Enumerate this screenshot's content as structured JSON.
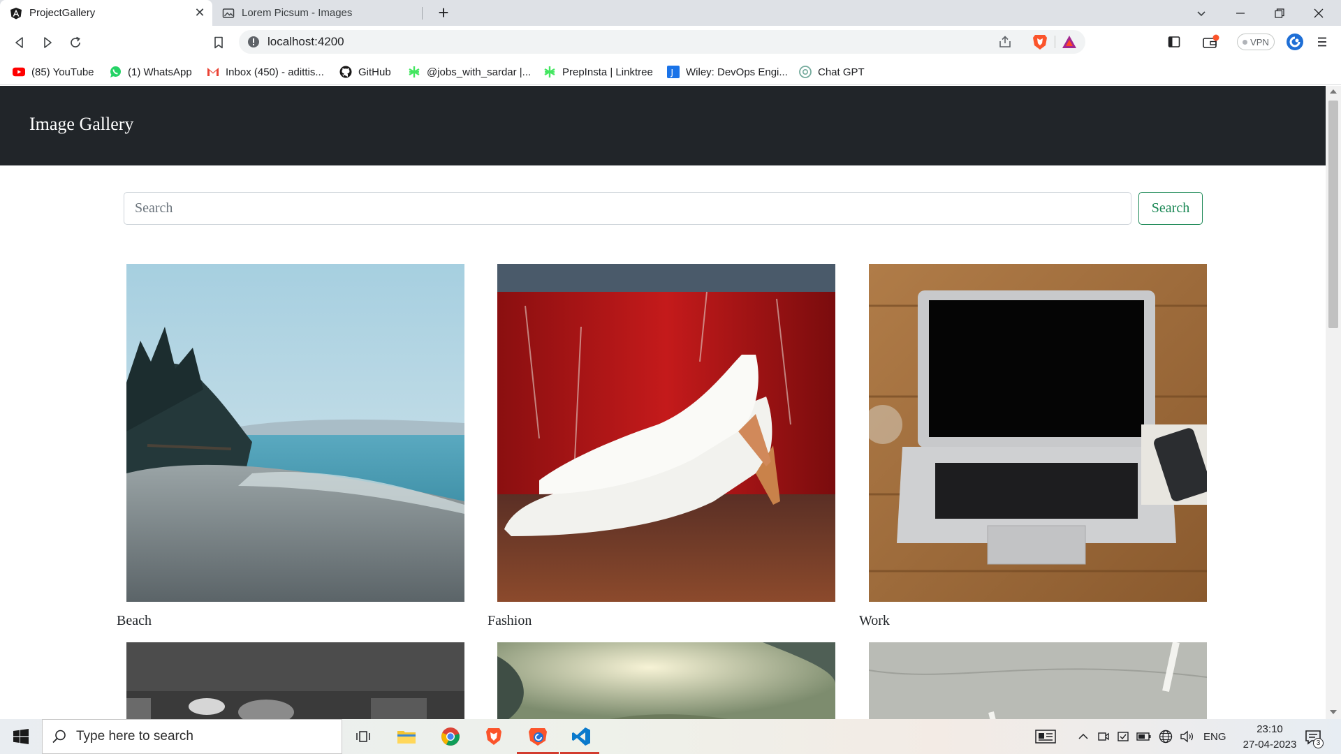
{
  "browser": {
    "tabs": [
      {
        "title": "ProjectGallery",
        "active": true,
        "icon": "angular-icon"
      },
      {
        "title": "Lorem Picsum - Images",
        "active": false,
        "icon": "image-icon"
      }
    ],
    "url": "localhost:4200",
    "vpn_label": "VPN",
    "bookmarks": [
      {
        "label": "(85) YouTube",
        "icon": "youtube-icon",
        "color": "#ff0000"
      },
      {
        "label": "(1) WhatsApp",
        "icon": "whatsapp-icon",
        "color": "#25d366"
      },
      {
        "label": "Inbox (450) - adittis...",
        "icon": "gmail-icon",
        "color": "#ea4335"
      },
      {
        "label": "GitHub",
        "icon": "github-icon",
        "color": "#181717"
      },
      {
        "label": "@jobs_with_sardar |...",
        "icon": "linktree-icon",
        "color": "#43e660"
      },
      {
        "label": "PrepInsta | Linktree",
        "icon": "linktree-icon",
        "color": "#43e660"
      },
      {
        "label": "Wiley: DevOps Engi...",
        "icon": "wiley-icon",
        "color": "#1a73e8"
      },
      {
        "label": "Chat GPT",
        "icon": "chatgpt-icon",
        "color": "#74aa9c"
      }
    ]
  },
  "app": {
    "brand": "Image Gallery",
    "search": {
      "placeholder": "Search",
      "value": "",
      "button_label": "Search"
    },
    "cards": [
      {
        "caption": "Beach"
      },
      {
        "caption": "Fashion"
      },
      {
        "caption": "Work"
      },
      {
        "caption": ""
      },
      {
        "caption": ""
      },
      {
        "caption": ""
      }
    ]
  },
  "taskbar": {
    "search_placeholder": "Type here to search",
    "language": "ENG",
    "time": "23:10",
    "date": "27-04-2023",
    "notification_count": "3"
  },
  "colors": {
    "navbar": "#212529",
    "search_button": "#198754",
    "tab_strip": "#dee1e6"
  }
}
